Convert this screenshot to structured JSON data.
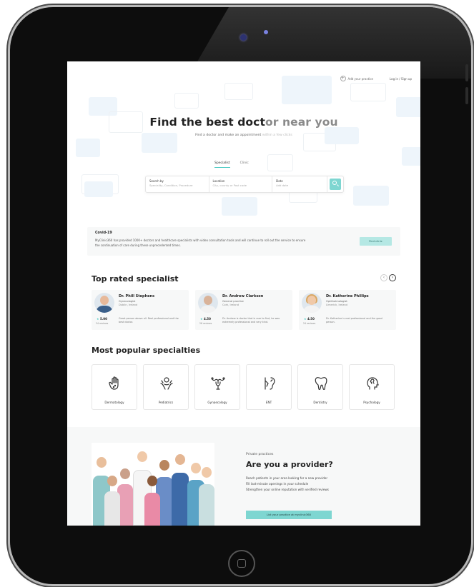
{
  "topbar": {
    "add_practice": "Add your practice",
    "login": "Log in / Sign up"
  },
  "hero": {
    "title_strong": "Find the best doct",
    "title_fade": "or near you",
    "subtitle_strong": "Find a doctor and make an appointment ",
    "subtitle_fade": "within a few clicks"
  },
  "tabs": [
    {
      "label": "Specialist"
    },
    {
      "label": "Clinic"
    }
  ],
  "search": {
    "search_by_label": "Search by",
    "search_by_placeholder": "Speciality, Condition, Procedure",
    "location_label": "Location",
    "location_placeholder": "City, county or Post code",
    "date_label": "Date",
    "date_placeholder": "Add date"
  },
  "covid": {
    "title": "Covid-19",
    "text": "MyClinic360 has provided 1000+ doctors and healthcare specialists with video consultation tools and will continue to roll out the service to ensure the continuation of care during these unprecedented times.",
    "button": "Find clinic"
  },
  "top_rated": {
    "title": "Top rated specialist",
    "prev": "‹",
    "next": "›",
    "doctors": [
      {
        "name": "Dr. Phill Stephens",
        "specialty": "Gynecologist",
        "location": "Dublin, Ireland",
        "rating": "5.00",
        "reviews": "34 reviews",
        "description": "Great person above all. Real professional and the best doctor."
      },
      {
        "name": "Dr. Andrew Clarkson",
        "specialty": "General practice",
        "location": "Cork, Ireland",
        "rating": "4.50",
        "reviews": "26 reviews",
        "description": "Dr. Andrew is doctor that is rare to find, he was extremely professional and very kind."
      },
      {
        "name": "Dr. Katherine Phillips",
        "specialty": "Ophthalmologist",
        "location": "Limerick, Ireland",
        "rating": "4.50",
        "reviews": "24 reviews",
        "description": "Dr. Katherine is real professional and the good person."
      }
    ]
  },
  "specialties": {
    "title": "Most popular specialties",
    "items": [
      {
        "label": "Dermatology",
        "icon": "hand-icon"
      },
      {
        "label": "Pediatrics",
        "icon": "baby-hands-icon"
      },
      {
        "label": "Gynaecology",
        "icon": "uterus-icon"
      },
      {
        "label": "ENT",
        "icon": "ear-icon"
      },
      {
        "label": "Dentistry",
        "icon": "tooth-icon"
      },
      {
        "label": "Psychology",
        "icon": "brain-head-icon"
      }
    ]
  },
  "provider": {
    "category": "Private practices",
    "title": "Are you a provider?",
    "line1": "Reach patients in your area looking for a new provider",
    "line2": "Fill last-minute openings in your schedule",
    "line3": "Strengthen your online reputation with verified reviews",
    "button": "List your practice at myclinic360"
  },
  "colors": {
    "accent": "#7ed6d1",
    "accent_light": "#b5e8e4",
    "device_frame": "#0d0d0d"
  }
}
